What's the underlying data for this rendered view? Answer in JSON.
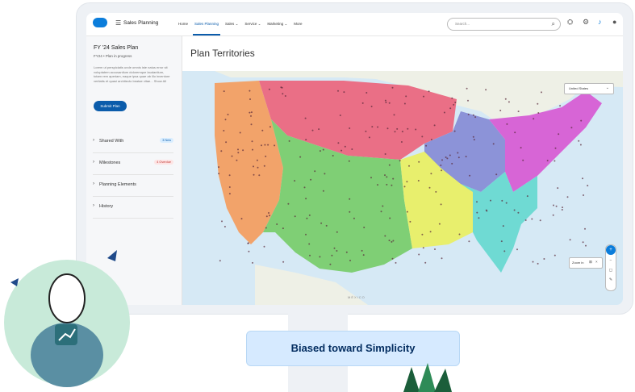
{
  "app": {
    "name": "Sales Planning",
    "nav": [
      "Home",
      "Sales Planning",
      "Sales",
      "Service",
      "Marketing",
      "More"
    ],
    "nav_active": "Sales Planning",
    "search_placeholder": "Search..."
  },
  "sidebar": {
    "title": "FY '24 Sales Plan",
    "subtitle": "FY24 • Plan in progress",
    "description": "Lorem ut perspiciatis unde omnis iste natus error sit voluptatem accusantium doloremque laudantium, totam rem aperiam, eaque ipsa quae ab illo inventore veritatis et quasi architecto beatae vitae...  Show All",
    "submit_label": "Submit Plan",
    "sections": [
      {
        "label": "Shared With",
        "badge": "3 New",
        "badge_color": "#d8edff",
        "badge_text_color": "#0b5cab"
      },
      {
        "label": "Milestones",
        "badge": "4 Overdue",
        "badge_color": "#fde4e4",
        "badge_text_color": "#c23934"
      },
      {
        "label": "Planning Elements",
        "badge": ""
      },
      {
        "label": "History",
        "badge": ""
      }
    ]
  },
  "main": {
    "page_title": "Plan Territories",
    "country_select": "United States",
    "zoom_label": "Zoom in",
    "map_label": "MÉXICO",
    "territory_colors": [
      "#f2a36a",
      "#ea6f86",
      "#7fcf75",
      "#e8ef6d",
      "#8c93d8",
      "#d765d6",
      "#6fdad3",
      "#b98ad6"
    ]
  },
  "caption": "Biased toward Simplicity"
}
